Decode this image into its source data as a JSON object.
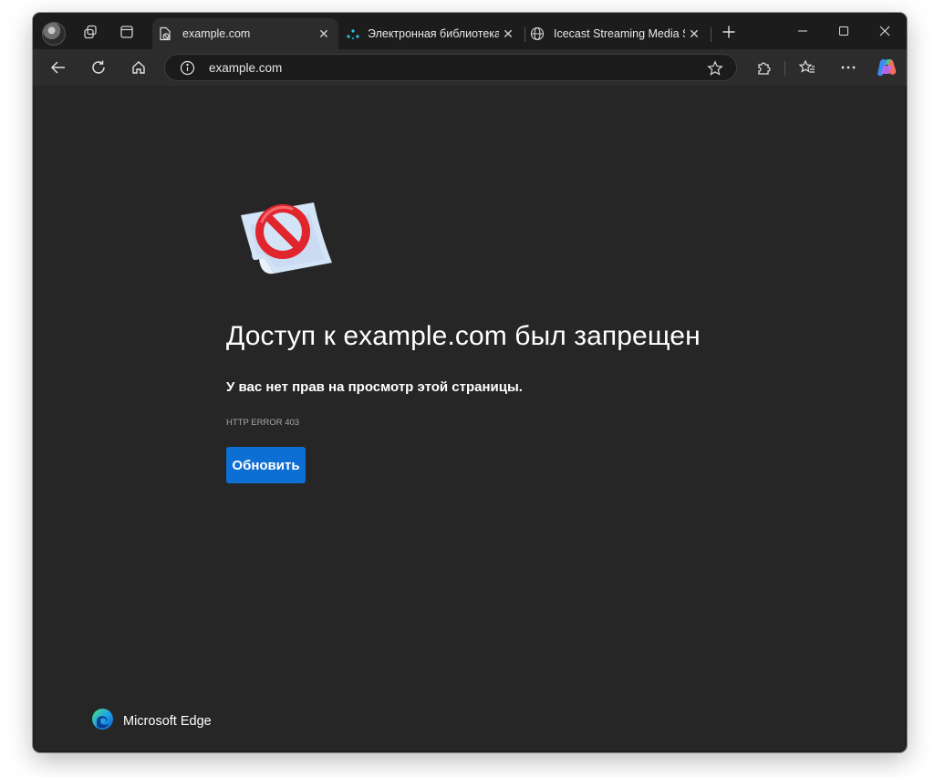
{
  "tabs": [
    {
      "label": "example.com",
      "active": true,
      "icon": "blocked-page-icon"
    },
    {
      "label": "Электронная библиотека",
      "active": false,
      "icon": "dots-logo-icon"
    },
    {
      "label": "Icecast Streaming Media Se",
      "active": false,
      "icon": "globe-icon"
    }
  ],
  "address": {
    "url": "example.com"
  },
  "error": {
    "title": "Доступ к example.com был запрещен",
    "description": "У вас нет прав на просмотр этой страницы.",
    "code": "HTTP ERROR 403",
    "button_label": "Обновить"
  },
  "footer": {
    "brand": "Microsoft Edge"
  },
  "colors": {
    "accent": "#0d6fd3",
    "background": "#262626",
    "tab_bar": "#1c1c1c"
  }
}
